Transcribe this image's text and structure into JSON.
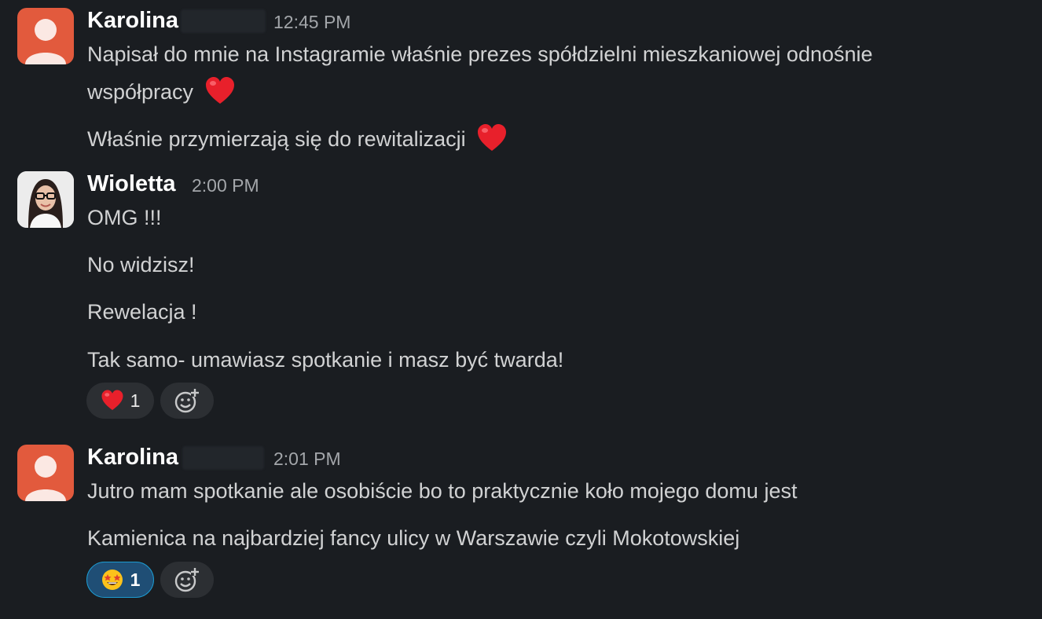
{
  "messages": [
    {
      "author": "Karolina",
      "time": "12:45 PM",
      "avatar": "default-avatar-icon",
      "lines": [
        "Napisał do mnie na Instagramie właśnie prezes spółdzielni mieszkaniowej odnośnie",
        "współpracy",
        "Właśnie przymierzają się do rewitalizacji"
      ]
    },
    {
      "author": "Wioletta",
      "time": "2:00 PM",
      "avatar": "profile-photo",
      "lines": [
        "OMG !!!",
        "No widzisz!",
        "Rewelacja !",
        "Tak samo- umawiasz spotkanie i masz być twarda!"
      ],
      "reactions": [
        {
          "emoji": "heart-emoji-icon",
          "count": "1"
        }
      ]
    },
    {
      "author": "Karolina",
      "time": "2:01 PM",
      "avatar": "default-avatar-icon",
      "lines": [
        "Jutro mam spotkanie ale osobiście bo to praktycznie koło mojego domu jest",
        "Kamienica na najbardziej fancy ulicy w Warszawie czyli Mokotowskiej"
      ],
      "reactions": [
        {
          "emoji": "star-struck-emoji-icon",
          "count": "1"
        }
      ]
    }
  ],
  "colors": {
    "background": "#1a1d21",
    "text": "#d1d2d3",
    "timestamp": "#a3a6aa",
    "avatar_default": "#e25a3d",
    "reaction_active": "#1f4e75",
    "reaction_active_border": "#1d9bd1",
    "heart": "#e8202b"
  }
}
